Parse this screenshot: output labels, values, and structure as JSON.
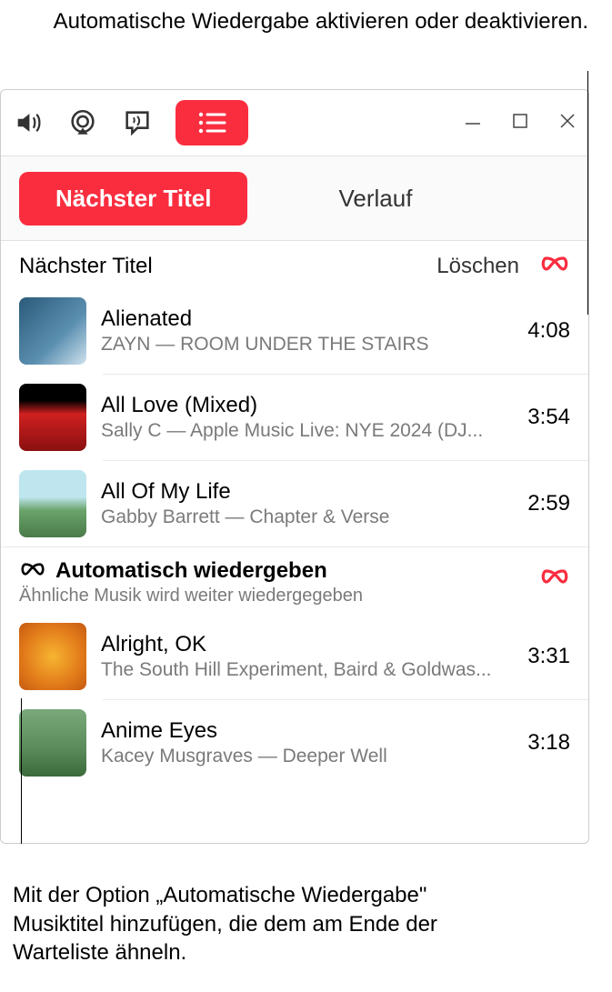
{
  "callouts": {
    "top": "Automatische Wiedergabe aktivieren oder deaktivieren.",
    "bottom": "Mit der Option „Automatische Wiedergabe\" Musiktitel hinzufügen, die dem am Ende der Warteliste ähneln."
  },
  "tabs": {
    "next": "Nächster Titel",
    "history": "Verlauf"
  },
  "section": {
    "title": "Nächster Titel",
    "clear": "Löschen"
  },
  "queue": [
    {
      "title": "Alienated",
      "subtitle": "ZAYN — ROOM UNDER THE STAIRS",
      "duration": "4:08",
      "art": "linear-gradient(135deg,#2a5a7a 0%,#5b8fb0 60%,#cfe2ee 100%)"
    },
    {
      "title": "All Love (Mixed)",
      "subtitle": "Sally C — Apple Music Live: NYE 2024 (DJ...",
      "duration": "3:54",
      "art": "linear-gradient(180deg,#000 0%,#000 25%,#d02020 45%,#8a1010 100%)"
    },
    {
      "title": "All Of My Life",
      "subtitle": "Gabby Barrett — Chapter & Verse",
      "duration": "2:59",
      "art": "linear-gradient(180deg,#bfe6ef 0%,#bfe6ef 40%,#6aa36a 60%,#4a7a4a 100%)"
    }
  ],
  "autoplay": {
    "title": "Automatisch wiedergeben",
    "subtitle": "Ähnliche Musik wird weiter wiedergegeben"
  },
  "autoplay_tracks": [
    {
      "title": "Alright, OK",
      "subtitle": "The South Hill Experiment, Baird & Goldwas...",
      "duration": "3:31",
      "art": "radial-gradient(circle,#f7b531 0%,#e27b1a 60%,#c55a10 100%)"
    },
    {
      "title": "Anime Eyes",
      "subtitle": "Kacey Musgraves — Deeper Well",
      "duration": "3:18",
      "art": "linear-gradient(180deg,#7aa87a 0%,#5a8a5a 60%,#3a6a3a 100%)"
    }
  ]
}
